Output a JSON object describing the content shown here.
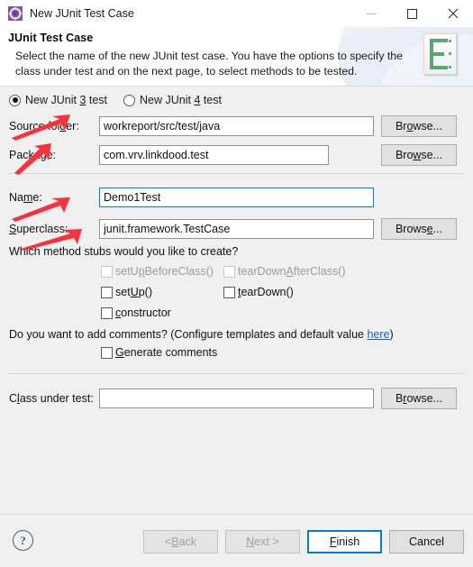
{
  "window": {
    "title": "New JUnit Test Case",
    "icon": "junit-gear-icon",
    "controls": {
      "minimize": "minimize-icon",
      "maximize": "maximize-icon",
      "close": "close-icon"
    }
  },
  "header": {
    "title": "JUnit Test Case",
    "description": "Select the name of the new JUnit test case. You have the options to specify the class under test and on the next page, to select methods to be tested.",
    "banner_icon": "junit-wizard-banner-icon"
  },
  "version_radio": {
    "options": [
      {
        "label": "New JUnit 3 test",
        "mnemonic": "3",
        "selected": true
      },
      {
        "label": "New JUnit 4 test",
        "mnemonic": "4",
        "selected": false
      }
    ]
  },
  "fields": {
    "source_folder": {
      "label": "Source folder:",
      "mnemonic": "d",
      "value": "workreport/src/test/java",
      "placeholder": "",
      "browse_label": "Browse...",
      "browse_mnemonic": "o",
      "focused": false
    },
    "package": {
      "label": "Package:",
      "mnemonic": "k",
      "value": "com.vrv.linkdood.test",
      "placeholder": "",
      "browse_label": "Browse...",
      "browse_mnemonic": "w",
      "focused": false
    },
    "name": {
      "label": "Name:",
      "mnemonic": "m",
      "value": "Demo1Test",
      "placeholder": "",
      "focused": true
    },
    "superclass": {
      "label": "Superclass:",
      "mnemonic": "S",
      "value": "junit.framework.TestCase",
      "placeholder": "",
      "browse_label": "Browse...",
      "browse_mnemonic": "e",
      "focused": false
    },
    "class_under_test": {
      "label": "Class under test:",
      "mnemonic": "l",
      "value": "",
      "placeholder": "",
      "browse_label": "Browse...",
      "browse_mnemonic": "r",
      "focused": false
    }
  },
  "stubs": {
    "question": "Which method stubs would you like to create?",
    "items": [
      {
        "label": "setUpBeforeClass()",
        "mnemonic": "p",
        "checked": false,
        "enabled": false
      },
      {
        "label": "tearDownAfterClass()",
        "mnemonic": "A",
        "checked": false,
        "enabled": false
      },
      {
        "label": "setUp()",
        "mnemonic": "U",
        "checked": false,
        "enabled": true
      },
      {
        "label": "tearDown()",
        "mnemonic": "t",
        "checked": false,
        "enabled": true
      },
      {
        "label": "constructor",
        "mnemonic": "c",
        "checked": false,
        "enabled": true
      }
    ]
  },
  "comments": {
    "question_prefix": "Do you want to add comments? (Configure templates and default value ",
    "link_text": "here",
    "question_suffix": ")",
    "checkbox": {
      "label": "Generate comments",
      "mnemonic": "G",
      "checked": false
    }
  },
  "footer": {
    "help_icon": "help-icon",
    "help_glyph": "?",
    "buttons": [
      {
        "label": "< Back",
        "mnemonic": "B",
        "enabled": false,
        "default": false
      },
      {
        "label": "Next >",
        "mnemonic": "N",
        "enabled": false,
        "default": false
      },
      {
        "label": "Finish",
        "mnemonic": "F",
        "enabled": true,
        "default": true
      },
      {
        "label": "Cancel",
        "mnemonic": "",
        "enabled": true,
        "default": false
      }
    ]
  },
  "annotations": {
    "arrow_color": "#f5333f",
    "arrows": [
      {
        "name": "arrow-source-folder",
        "target": "Source folder:"
      },
      {
        "name": "arrow-package",
        "target": "Package:"
      },
      {
        "name": "arrow-name",
        "target": "Name:"
      },
      {
        "name": "arrow-superclass",
        "target": "Superclass:"
      }
    ]
  }
}
